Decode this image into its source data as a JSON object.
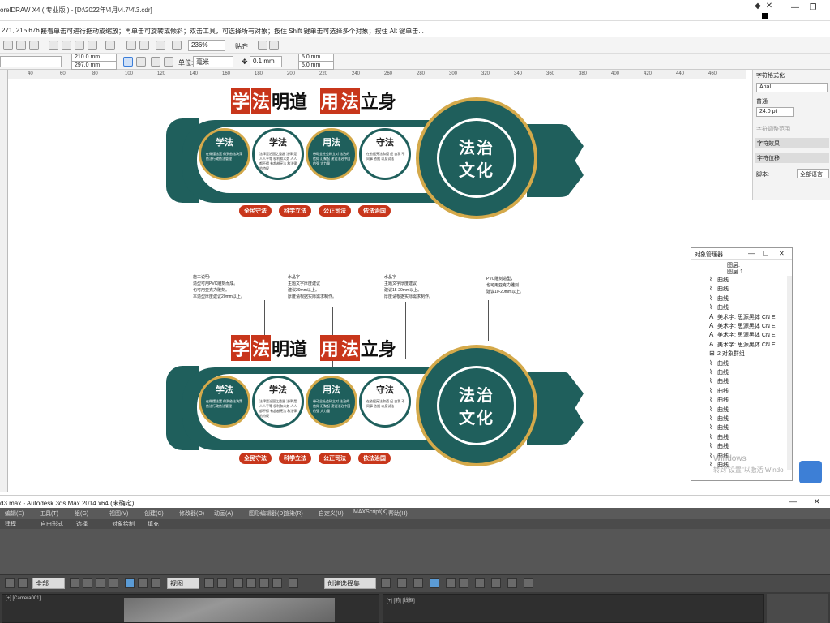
{
  "corel": {
    "title": "orelDRAW X4 ( 专业版 ) - [D:\\2022年\\4月\\4.7\\4\\3.cdr]",
    "coords": "271, 215.676 )",
    "hint": "接着单击可进行拖动或缩放；再单击可旋转或倾斜；双击工具，可选择所有对象；按住 Shift 键单击可选择多个对象；按住 Alt 键单击...",
    "zoom": "236%",
    "snap_label": "贴齐",
    "width_value": "210.0 mm",
    "height_value": "297.0 mm",
    "unit_label": "单位:",
    "unit_value": "毫米",
    "nudge_value": "0.1 mm",
    "dup_x": "5.0 mm",
    "dup_y": "5.0 mm",
    "ruler_ticks": [
      "40",
      "60",
      "80",
      "100",
      "120",
      "140",
      "160",
      "180",
      "200",
      "220",
      "240",
      "260",
      "280",
      "300",
      "320",
      "340",
      "360",
      "380",
      "400",
      "420",
      "440",
      "460"
    ]
  },
  "banner": {
    "hl_1": "学",
    "hl_2": "法",
    "hl_3": "明道",
    "hl_4": "用",
    "hl_5": "法",
    "hl_6": "立身",
    "big_title_1": "法治",
    "big_title_2": "文化",
    "circles": [
      {
        "title": "学法",
        "desc": "在做懂法置 做到依法决策 依法行政依法管理"
      },
      {
        "title": "学法",
        "desc": "法律是治国之重器 法律 是人人平等 权利和义务 人人都不得 有超越宪法 和法律的特权"
      },
      {
        "title": "用法",
        "desc": "带动全社会树立对 法治的信仰 汇聚起 建设法治中国的强 大力量"
      },
      {
        "title": "守法",
        "desc": "在依据宪法和遵 纪 自我 不同事 依据 以身试法"
      }
    ],
    "tags": [
      "全民守法",
      "科学立法",
      "公正司法",
      "依法治国"
    ]
  },
  "notes": [
    "施工说明:\n造型可用PVC雕刻而成。\n也可用亚克力雕刻。\n本造型厚度建议20mm以上。",
    "水晶字\n主题文字厚度建议\n建议20mm以上。\n厚度请根据实际需求制作。",
    "水晶字\n主题文字厚度建议\n建议15-20mm以上。\n厚度请根据实际需求制作。",
    "PVC雕刻造型，\n也可用亚克力雕刻\n建议10-20mm以上。"
  ],
  "docker": {
    "header": "字符格式化",
    "font": "Arial",
    "style": "普通",
    "size": "24.0 pt",
    "kerning_label": "字符调整范围",
    "effects": "字符效果",
    "shift": "字符位移",
    "script_label": "脚本:",
    "script_value": "全部语言"
  },
  "object_manager": {
    "title": "对象管理器",
    "layer": "图层:",
    "layer1": "图层 1",
    "items": [
      {
        "icon": "曲",
        "label": "曲线"
      },
      {
        "icon": "曲",
        "label": "曲线"
      },
      {
        "icon": "曲",
        "label": "曲线"
      },
      {
        "icon": "曲",
        "label": "曲线"
      },
      {
        "icon": "A",
        "label": "美术字: 思源黑体 CN E"
      },
      {
        "icon": "A",
        "label": "美术字: 思源黑体 CN E"
      },
      {
        "icon": "A",
        "label": "美术字: 思源黑体 CN E"
      },
      {
        "icon": "A",
        "label": "美术字: 思源黑体 CN E"
      },
      {
        "icon": "⊞",
        "label": "2 对象群组"
      },
      {
        "icon": "曲",
        "label": "曲线"
      },
      {
        "icon": "曲",
        "label": "曲线"
      },
      {
        "icon": "曲",
        "label": "曲线"
      },
      {
        "icon": "曲",
        "label": "曲线"
      },
      {
        "icon": "曲",
        "label": "曲线"
      },
      {
        "icon": "曲",
        "label": "曲线"
      },
      {
        "icon": "曲",
        "label": "曲线"
      },
      {
        "icon": "曲",
        "label": "曲线"
      },
      {
        "icon": "曲",
        "label": "曲线"
      },
      {
        "icon": "曲",
        "label": "曲线"
      },
      {
        "icon": "曲",
        "label": "曲线"
      },
      {
        "icon": "曲",
        "label": "曲线"
      }
    ],
    "watermark1": "Windows",
    "watermark2": "转到\"设置\"以激活 Windo"
  },
  "max": {
    "title": "d3.max - Autodesk 3ds Max  2014 x64   (未确定)",
    "menu": [
      "编辑(E)",
      "工具(T)",
      "组(G)",
      "视图(V)",
      "创建(C)",
      "修改器(O)",
      "动画(A)",
      "图形编辑器(D)",
      "渲染(R)",
      "自定义(U)",
      "MAXScript(X)",
      "帮助(H)"
    ],
    "ribbon": [
      "建模",
      "自由形式",
      "选择",
      "对象绘制",
      "填充"
    ],
    "filter": "全部",
    "view_dropdown": "视图",
    "selection_set": "创建选择集",
    "viewport1": "[+] [Camera001]",
    "viewport2": "[+] [前] [线框]"
  }
}
